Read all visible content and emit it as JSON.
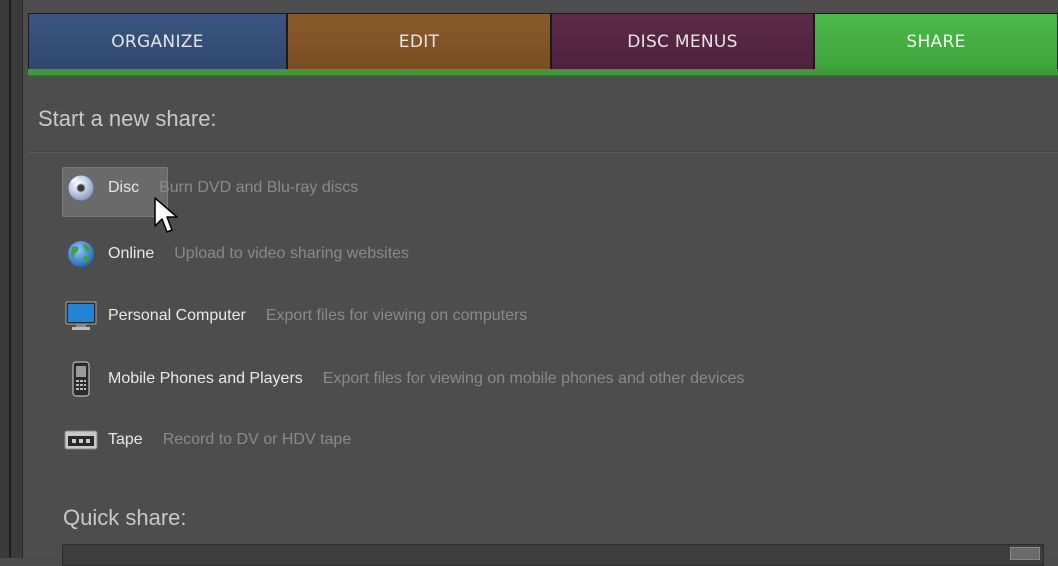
{
  "tabs": {
    "organize": "ORGANIZE",
    "edit": "EDIT",
    "disc_menus": "DISC MENUS",
    "share": "SHARE"
  },
  "start_section": {
    "title": "Start a new share:"
  },
  "options": [
    {
      "label": "Disc",
      "desc": "Burn DVD and Blu-ray discs",
      "icon": "disc-icon"
    },
    {
      "label": "Online",
      "desc": "Upload to video sharing websites",
      "icon": "globe-icon"
    },
    {
      "label": "Personal Computer",
      "desc": "Export files for viewing on computers",
      "icon": "monitor-icon"
    },
    {
      "label": "Mobile Phones and Players",
      "desc": "Export files for viewing on mobile phones and other devices",
      "icon": "phone-icon"
    },
    {
      "label": "Tape",
      "desc": "Record to DV or HDV tape",
      "icon": "tape-icon"
    }
  ],
  "quick_section": {
    "title": "Quick share:"
  },
  "colors": {
    "organize_tab": "#2f4870",
    "edit_tab": "#7a4d22",
    "disc_menus_tab": "#4e223d",
    "share_tab": "#3ea43c",
    "background": "#4d4d4d"
  }
}
